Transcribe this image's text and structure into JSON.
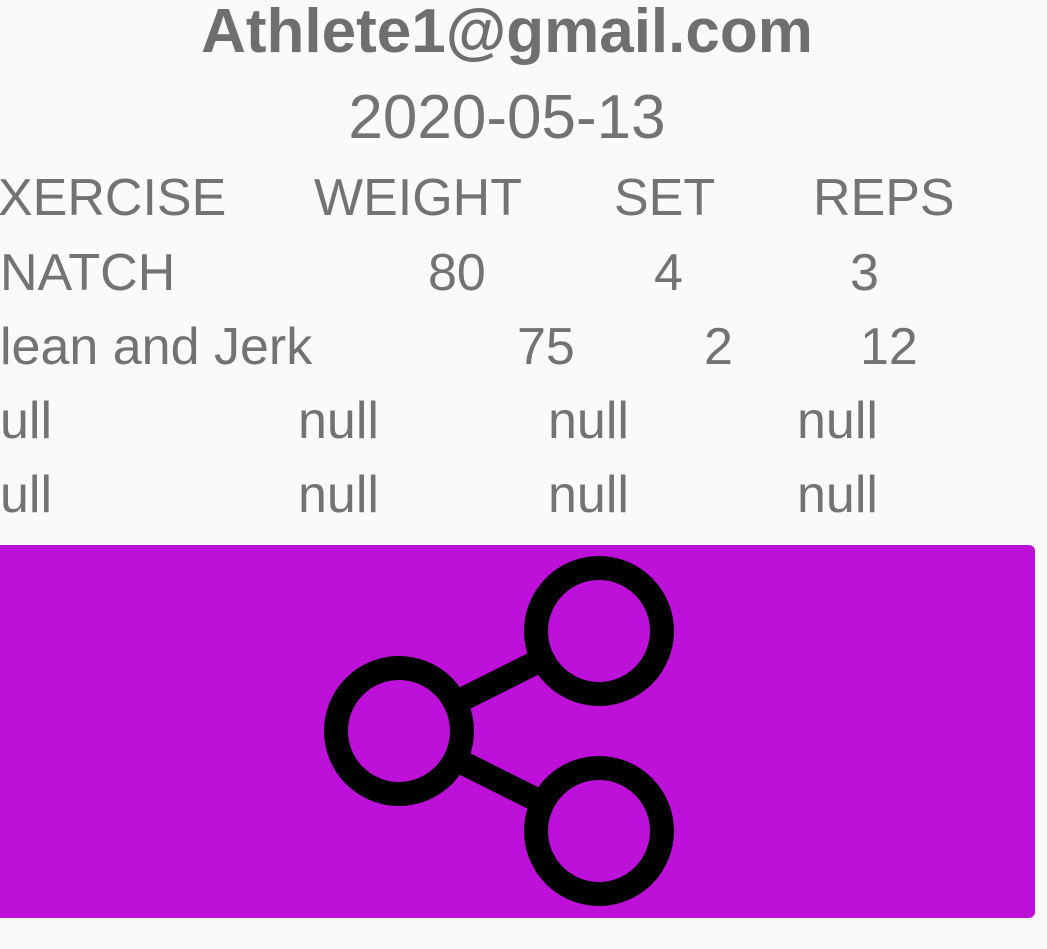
{
  "header": {
    "email": "Athlete1@gmail.com",
    "date": "2020-05-13"
  },
  "table": {
    "columns": [
      "XERCISE",
      "WEIGHT",
      "SET",
      "REPS"
    ],
    "rows": [
      [
        "NATCH",
        "80",
        "4",
        "3"
      ],
      [
        "lean and Jerk",
        "75",
        "2",
        "12"
      ],
      [
        "ull",
        "null",
        "null",
        "null"
      ],
      [
        "ull",
        "null",
        "null",
        "null"
      ]
    ]
  },
  "share_button": {
    "icon": "share-icon",
    "color": "#bd10d9"
  }
}
